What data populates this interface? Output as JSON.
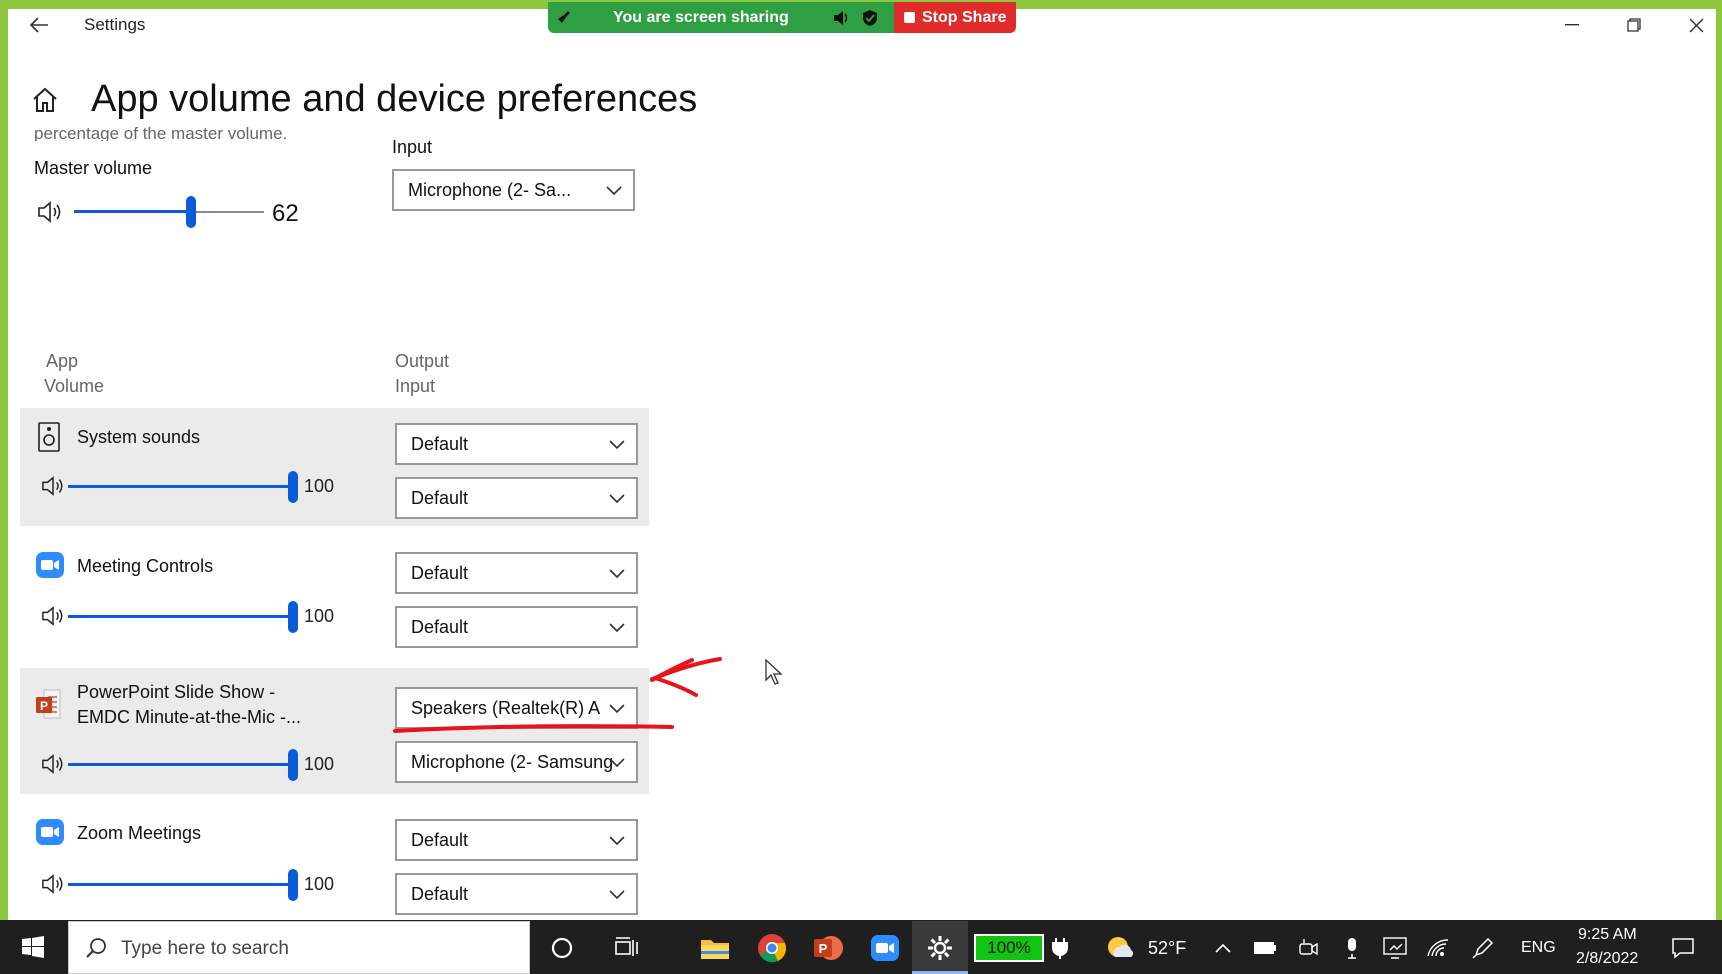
{
  "window": {
    "title": "Settings",
    "controls": {
      "minimize": "—",
      "restore": "❐",
      "close": "✕"
    }
  },
  "share": {
    "status": "You are screen sharing",
    "stop_label": "Stop Share"
  },
  "page": {
    "title": "App volume and device preferences",
    "cut_text": "percentage of the master volume."
  },
  "master": {
    "label": "Master volume",
    "value": "62",
    "level": 0.62
  },
  "input_section": {
    "label": "Input",
    "selected": "Microphone (2- Sa..."
  },
  "columns": {
    "app": "App",
    "volume": "Volume",
    "output": "Output",
    "input": "Input"
  },
  "apps": [
    {
      "name_line1": "System sounds",
      "name_line2": "",
      "volume": "100",
      "level": 1.0,
      "output": "Default",
      "input": "Default",
      "icon": "speaker-box-icon"
    },
    {
      "name_line1": "Meeting Controls",
      "name_line2": "",
      "volume": "100",
      "level": 1.0,
      "output": "Default",
      "input": "Default",
      "icon": "zoom-camera-icon"
    },
    {
      "name_line1": "PowerPoint Slide Show  -",
      "name_line2": "EMDC Minute-at-the-Mic -...",
      "volume": "100",
      "level": 1.0,
      "output": "Speakers (Realtek(R) A",
      "input": "Microphone (2- Samsung",
      "icon": "powerpoint-icon"
    },
    {
      "name_line1": "Zoom Meetings",
      "name_line2": "",
      "volume": "100",
      "level": 1.0,
      "output": "Default",
      "input": "Default",
      "icon": "zoom-camera-icon"
    }
  ],
  "taskbar": {
    "search_placeholder": "Type here to search",
    "battery": "100%",
    "temperature": "52°F",
    "language": "ENG",
    "time": "9:25 AM",
    "date": "2/8/2022"
  },
  "colors": {
    "accent": "#0a5bd8",
    "share_green": "#2ea043",
    "stop_red": "#e02b2b",
    "frame_green": "#8dc63f",
    "annotation_red": "#e8141c"
  }
}
